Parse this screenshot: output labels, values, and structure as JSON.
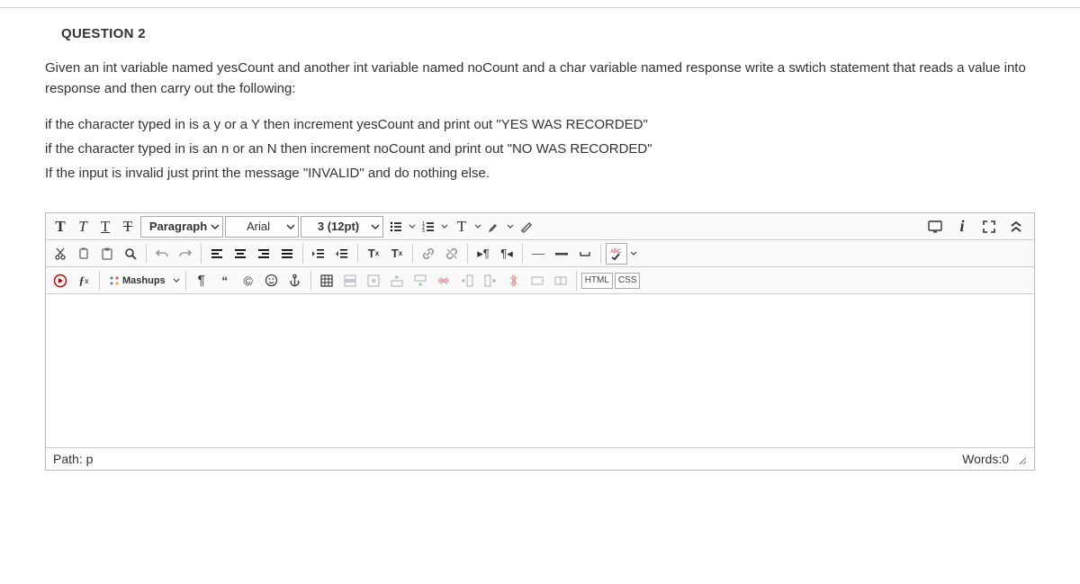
{
  "question": {
    "title": "QUESTION 2",
    "p1": "Given an int variable named yesCount and another int variable named noCount and a char variable named response write a swtich statement that reads a value into response and then carry out the following:",
    "p2": "if the character typed in is a y or a Y then increment yesCount and print out \"YES WAS RECORDED\"",
    "p3": "if the character typed in is an n or an N then increment noCount and print out \"NO WAS RECORDED\"",
    "p4": "If the input is invalid just print the message \"INVALID\" and do nothing else."
  },
  "toolbar": {
    "block_format": "Paragraph",
    "font_family": "Arial",
    "font_size": "3 (12pt)",
    "mashups_label": "Mashups",
    "html_btn": "HTML",
    "css_btn": "CSS"
  },
  "status": {
    "path_label": "Path: p",
    "words_label": "Words:0"
  }
}
